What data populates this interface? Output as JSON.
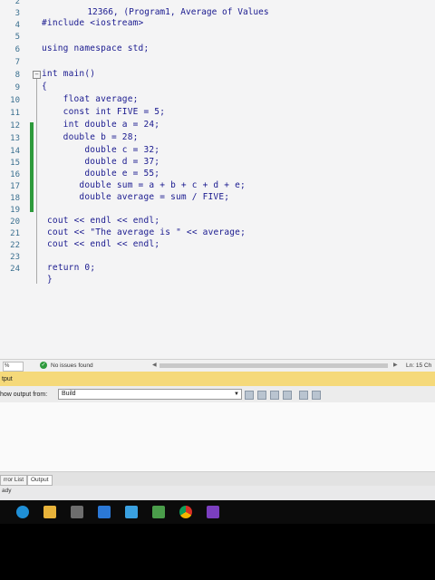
{
  "window": {
    "title": "(Program1, Average of Values",
    "title_fragment": "12366,"
  },
  "editor": {
    "line_numbers": [
      "2",
      "3",
      "4",
      "5",
      "6",
      "7",
      "8",
      "9",
      "10",
      "11",
      "12",
      "13",
      "14",
      "15",
      "16",
      "17",
      "18",
      "19",
      "20",
      "21",
      "22",
      "23",
      "24"
    ],
    "lines": [
      "",
      "#include <iostream>",
      "",
      "using namespace std;",
      "",
      "int main()",
      "{",
      "    float average;",
      "    const int FIVE = 5;",
      "    int double a = 24;",
      "    double b = 28;",
      "        double c = 32;",
      "        double d = 37;",
      "        double e = 55;",
      "       double sum = a + b + c + d + e;",
      "       double average = sum / FIVE;",
      "",
      "cout << endl << endl;",
      "cout << \"The average is \" << average;",
      "cout << endl << endl;",
      "",
      "return 0;",
      "}"
    ],
    "fold_icon": "minus"
  },
  "statusbar": {
    "zoom": "%",
    "issues": "No issues found",
    "ln": "Ln: 15",
    "ch": "Ch"
  },
  "output": {
    "title": "tput",
    "show_output_from": "how output from:",
    "source": "Build"
  },
  "tabs": [
    "rror List",
    "Output"
  ],
  "status": {
    "ready": "ady"
  },
  "colors": {
    "change_bar": "#2e9a3c",
    "output_header": "#f5d97a",
    "code_text": "#1a1a8f"
  },
  "taskbar_icons": [
    "edge-icon",
    "file-explorer-icon",
    "calculator-icon",
    "mail-icon",
    "store-icon",
    "photos-icon",
    "chrome-icon",
    "visual-studio-icon"
  ]
}
